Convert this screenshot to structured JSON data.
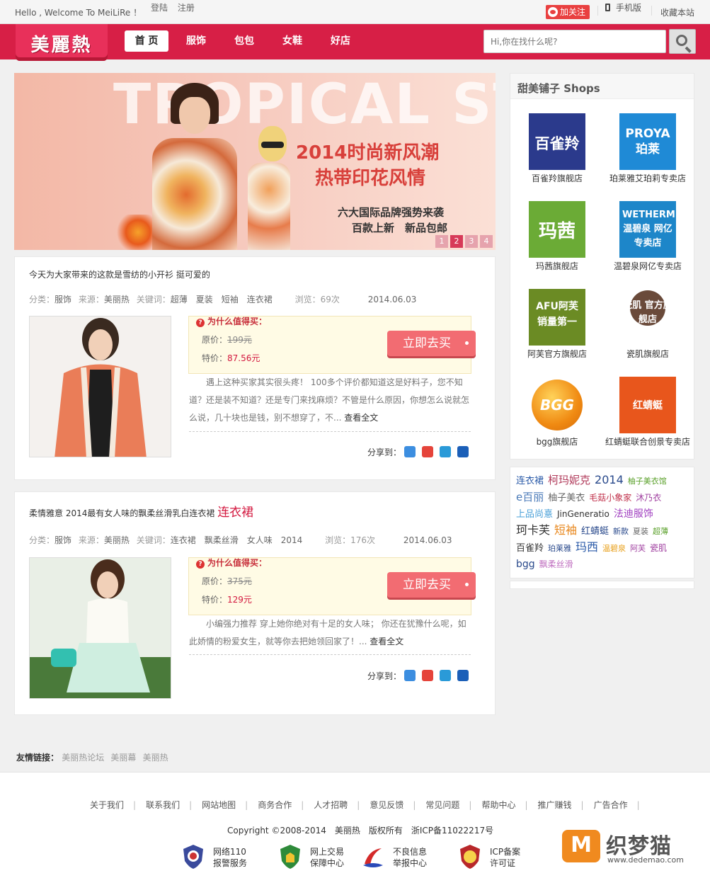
{
  "topbar": {
    "welcome": "Hello , Welcome To MeiLiRe ！",
    "login": "登陆",
    "register": "注册",
    "follow": "加关注",
    "mobile": "手机版",
    "favorite": "收藏本站"
  },
  "header": {
    "logo": "美麗熱",
    "nav": [
      "首 页",
      "服饰",
      "包包",
      "女鞋",
      "好店"
    ],
    "search_placeholder": "Hi,你在找什么呢?"
  },
  "banner": {
    "big_text": "TROPICAL STYLE",
    "title1": "2014时尚新风潮",
    "title2": "热带印花风情",
    "sub1": "六大国际品牌强势来袭",
    "sub2": "百款上新　新品包邮",
    "pages": [
      "1",
      "2",
      "3",
      "4"
    ],
    "active_page": 1
  },
  "labels": {
    "category": "分类：",
    "source": "来源：",
    "keywords": "关键词：",
    "views": "浏览：",
    "worth": "为什么值得买：",
    "orig_price": "原价：",
    "sale_price": "特价：",
    "goto": "立即去买",
    "share": "分享到：",
    "read_more": "查看全文"
  },
  "articles": [
    {
      "title": "今天为大家带来的这款是雪纺的小开衫 挺可爱的",
      "title_highlight": "",
      "category": "服饰",
      "source": "美丽热",
      "keywords": "超薄　夏装　短袖　连衣裙",
      "views": "69次",
      "date": "2014.06.03",
      "orig_price": "199元",
      "sale_price": "87.56元",
      "desc": "遇上这种买家其实很头疼！ 100多个评价都知道这是好料子，您不知道？还是装不知道？还是专门来找麻烦？不管是什么原因，你想怎么说就怎么说，几十块也是钱，别不想穿了，不... "
    },
    {
      "title": "柔情雅意 2014最有女人味的飘柔丝滑乳白连衣裙",
      "title_highlight": "连衣裙",
      "category": "服饰",
      "source": "美丽热",
      "keywords": "连衣裙　飘柔丝滑　女人味　2014",
      "views": "176次",
      "date": "2014.06.03",
      "orig_price": "375元",
      "sale_price": "129元",
      "desc": "小编强力推荐 穿上她你绝对有十足的女人味； 你还在犹豫什么呢，如此娇情的粉爱女生，就等你去把她领回家了！... "
    }
  ],
  "shops": {
    "title": "甜美铺子 Shops",
    "items": [
      {
        "logo": "百雀羚",
        "name": "百雀羚旗舰店",
        "color": "#2b3a8c"
      },
      {
        "logo": "PROYA 珀莱",
        "name": "珀莱雅艾珀莉专卖店",
        "color": "#1f8ad6"
      },
      {
        "logo": "玛茜",
        "name": "玛茜旗舰店",
        "color": "#6bab36"
      },
      {
        "logo": "WETHERM 温碧泉 网亿专卖店",
        "name": "温碧泉网亿专卖店",
        "color": "#1d86c9"
      },
      {
        "logo": "AFU阿芙 销量第一",
        "name": "阿芙官方旗舰店",
        "color": "#6b8b24"
      },
      {
        "logo": "瓷肌 官方旗舰店",
        "name": "瓷肌旗舰店",
        "color": "#6a4a3a"
      },
      {
        "logo": "BGG",
        "name": "bgg旗舰店",
        "color": "#f08a12"
      },
      {
        "logo": "红蜻蜓",
        "name": "红蜻蜓联合创景专卖店",
        "color": "#e8561c"
      }
    ]
  },
  "tags": [
    {
      "text": "连衣裙",
      "color": "#2a5aa8",
      "size": 13
    },
    {
      "text": "柯玛妮克",
      "color": "#b03a5a",
      "size": 15
    },
    {
      "text": "2014",
      "color": "#2a4a8c",
      "size": 16
    },
    {
      "text": "柚子美衣馆",
      "color": "#5aa02a",
      "size": 11
    },
    {
      "text": "e百丽",
      "color": "#4a7ab8",
      "size": 15
    },
    {
      "text": "柚子美衣",
      "color": "#666666",
      "size": 13
    },
    {
      "text": "毛菇小象家",
      "color": "#c0304a",
      "size": 12
    },
    {
      "text": "沐乃衣",
      "color": "#a040a0",
      "size": 12
    },
    {
      "text": "上品尚憙",
      "color": "#4aa0d8",
      "size": 13
    },
    {
      "text": "JinGeneratio",
      "color": "#333333",
      "size": 12
    },
    {
      "text": "法迪服饰",
      "color": "#a040c0",
      "size": 14
    },
    {
      "text": "珂卡芙",
      "color": "#333333",
      "size": 16
    },
    {
      "text": "短袖",
      "color": "#e8871c",
      "size": 16
    },
    {
      "text": "红蜻蜓",
      "color": "#2a4a8c",
      "size": 13
    },
    {
      "text": "新款",
      "color": "#2a4a8c",
      "size": 11
    },
    {
      "text": "夏装",
      "color": "#666666",
      "size": 11
    },
    {
      "text": "超薄",
      "color": "#5aa02a",
      "size": 11
    },
    {
      "text": "百雀羚",
      "color": "#333333",
      "size": 13
    },
    {
      "text": "珀莱雅",
      "color": "#2a4a8c",
      "size": 11
    },
    {
      "text": "玛西",
      "color": "#2a5aa8",
      "size": 16
    },
    {
      "text": "温碧泉",
      "color": "#e8a01c",
      "size": 11
    },
    {
      "text": "阿芙",
      "color": "#a040a0",
      "size": 11
    },
    {
      "text": "瓷肌",
      "color": "#a040a0",
      "size": 12
    },
    {
      "text": "bgg",
      "color": "#2a4a8c",
      "size": 14
    },
    {
      "text": "飘柔丝滑",
      "color": "#c070c0",
      "size": 12
    }
  ],
  "friend_links": {
    "label": "友情链接：",
    "links": [
      "美丽热论坛",
      "美丽幕",
      "美丽热"
    ]
  },
  "footer": {
    "links": [
      "关于我们",
      "联系我们",
      "网站地图",
      "商务合作",
      "人才招聘",
      "意见反馈",
      "常见问题",
      "帮助中心",
      "推广赚钱",
      "广告合作"
    ],
    "copyright": "Copyright ©2008-2014　美丽热　版权所有　浙ICP备11022217号",
    "badges": [
      {
        "line1": "网络110",
        "line2": "报警服务"
      },
      {
        "line1": "网上交易",
        "line2": "保障中心"
      },
      {
        "line1": "不良信息",
        "line2": "举报中心"
      },
      {
        "line1": "ICP备案",
        "line2": "许可证"
      }
    ],
    "brand_name": "织梦猫",
    "brand_url": "www.dedemao.com"
  }
}
